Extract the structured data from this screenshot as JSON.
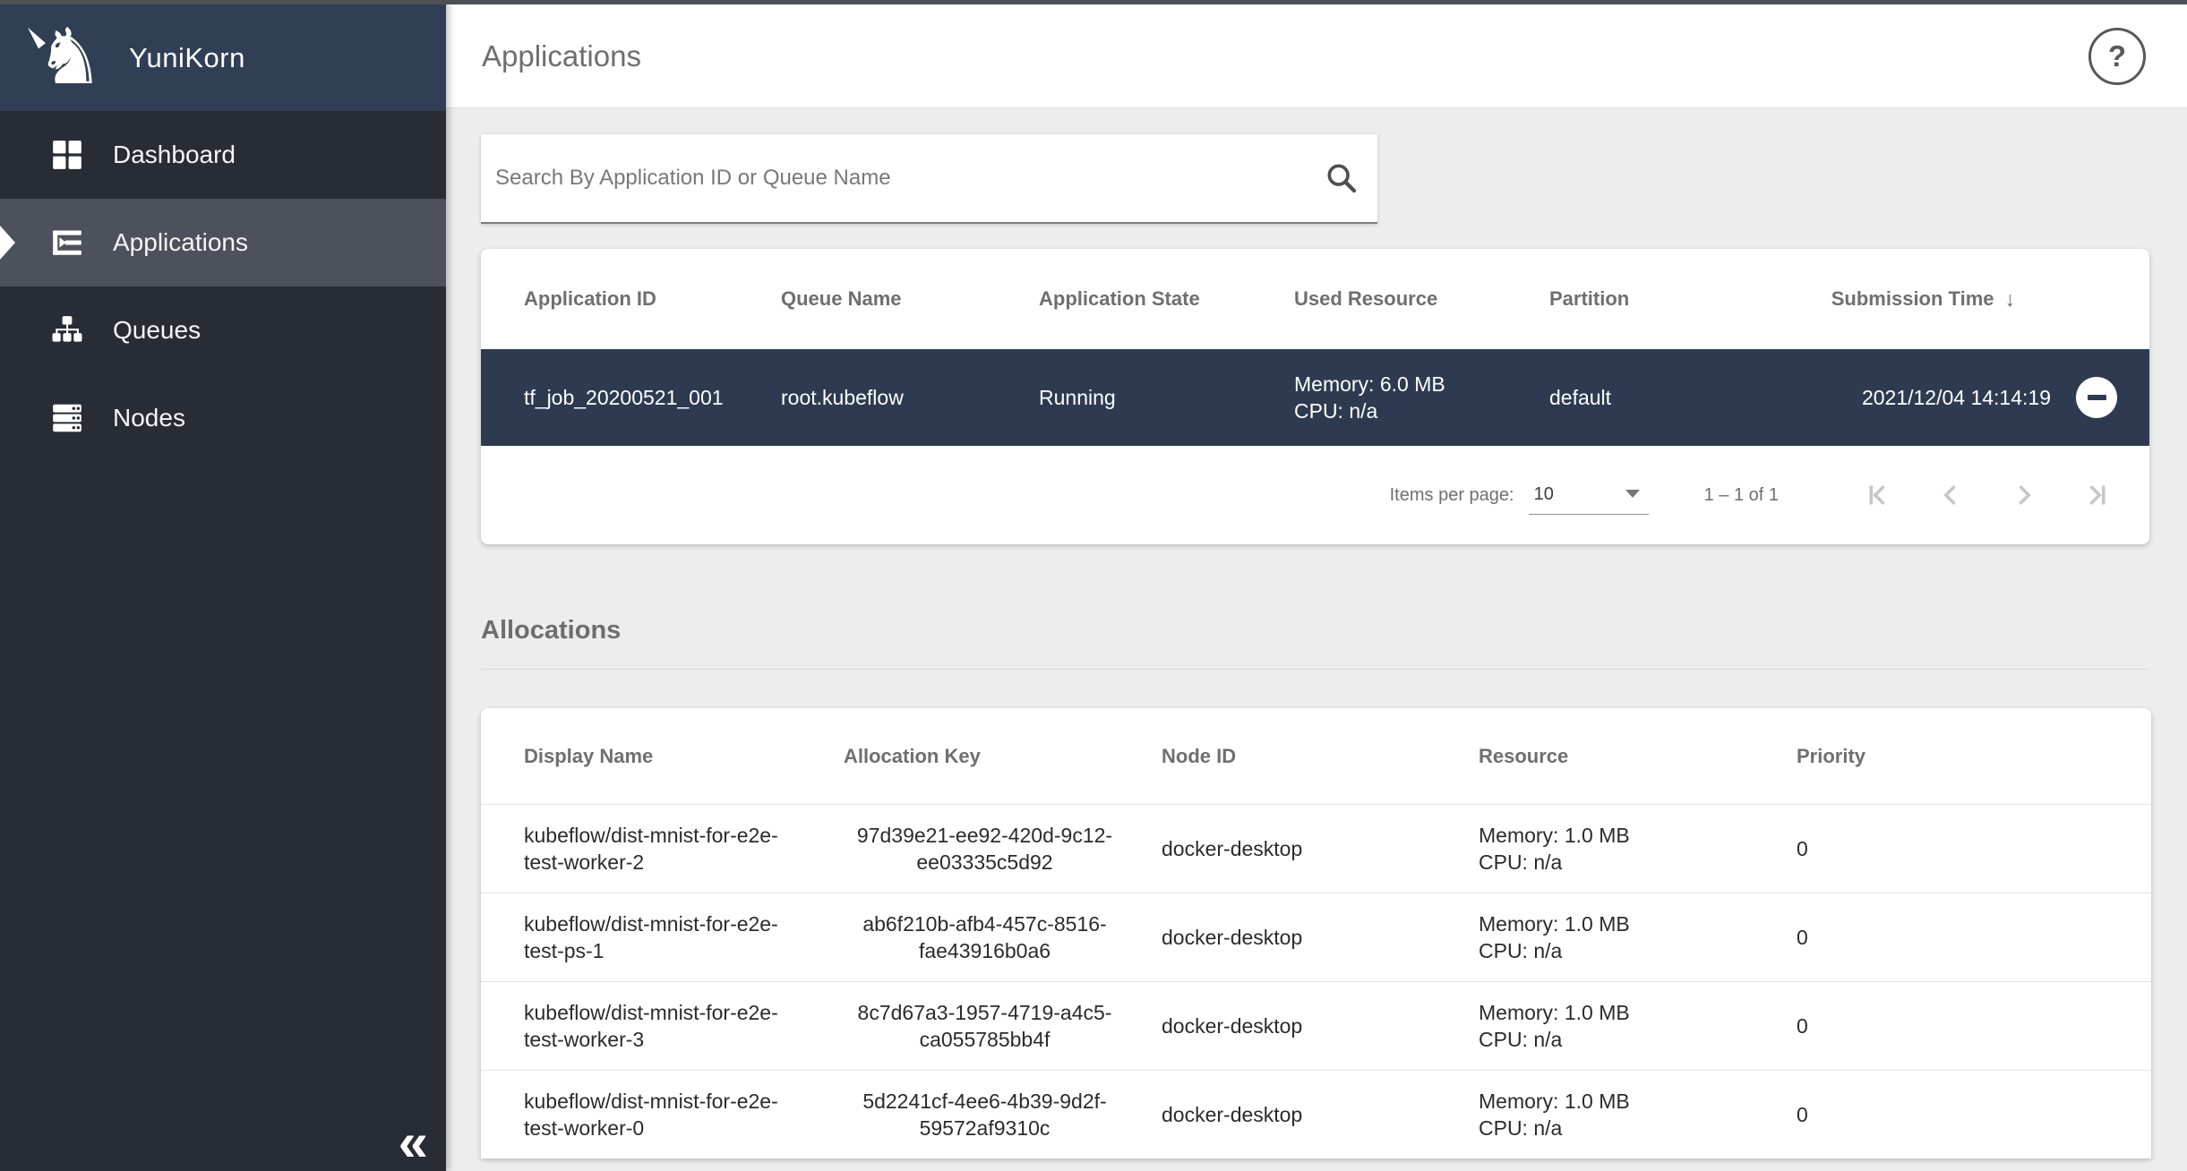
{
  "sidebar": {
    "brand": {
      "title": "YuniKorn"
    },
    "items": [
      {
        "label": "Dashboard"
      },
      {
        "label": "Applications"
      },
      {
        "label": "Queues"
      },
      {
        "label": "Nodes"
      }
    ],
    "collapse_glyph": "«"
  },
  "header": {
    "title": "Applications",
    "help_glyph": "?"
  },
  "search": {
    "placeholder": "Search By Application ID or Queue Name"
  },
  "applications_table": {
    "columns": [
      "Application ID",
      "Queue Name",
      "Application State",
      "Used Resource",
      "Partition",
      "Submission Time"
    ],
    "sort": {
      "column": "Submission Time",
      "direction": "desc",
      "arrow": "↓"
    },
    "rows": [
      {
        "application_id": "tf_job_20200521_001",
        "queue_name": "root.kubeflow",
        "application_state": "Running",
        "used_resource_line1": "Memory: 6.0 MB",
        "used_resource_line2": "CPU: n/a",
        "partition": "default",
        "submission_time": "2021/12/04 14:14:19",
        "selected": true
      }
    ],
    "paginator": {
      "items_per_page_label": "Items per page:",
      "items_per_page_value": "10",
      "range_label": "1 – 1 of 1"
    }
  },
  "allocations": {
    "section_title": "Allocations",
    "columns": [
      "Display Name",
      "Allocation Key",
      "Node ID",
      "Resource",
      "Priority"
    ],
    "rows": [
      {
        "display_name_line1": "kubeflow/dist-mnist-for-e2e-",
        "display_name_line2": "test-worker-2",
        "allocation_key_line1": "97d39e21-ee92-420d-9c12-",
        "allocation_key_line2": "ee03335c5d92",
        "node_id": "docker-desktop",
        "resource_line1": "Memory: 1.0 MB",
        "resource_line2": "CPU: n/a",
        "priority": "0"
      },
      {
        "display_name_line1": "kubeflow/dist-mnist-for-e2e-",
        "display_name_line2": "test-ps-1",
        "allocation_key_line1": "ab6f210b-afb4-457c-8516-",
        "allocation_key_line2": "fae43916b0a6",
        "node_id": "docker-desktop",
        "resource_line1": "Memory: 1.0 MB",
        "resource_line2": "CPU: n/a",
        "priority": "0"
      },
      {
        "display_name_line1": "kubeflow/dist-mnist-for-e2e-",
        "display_name_line2": "test-worker-3",
        "allocation_key_line1": "8c7d67a3-1957-4719-a4c5-",
        "allocation_key_line2": "ca055785bb4f",
        "node_id": "docker-desktop",
        "resource_line1": "Memory: 1.0 MB",
        "resource_line2": "CPU: n/a",
        "priority": "0"
      },
      {
        "display_name_line1": "kubeflow/dist-mnist-for-e2e-",
        "display_name_line2": "test-worker-0",
        "allocation_key_line1": "5d2241cf-4ee6-4b39-9d2f-",
        "allocation_key_line2": "59572af9310c",
        "node_id": "docker-desktop",
        "resource_line1": "Memory: 1.0 MB",
        "resource_line2": "CPU: n/a",
        "priority": "0"
      }
    ]
  },
  "colors": {
    "sidebar_header_bg": "#313f56",
    "sidebar_bg": "#282c34",
    "sidebar_selected_bg": "#4c515b",
    "selected_row_bg": "#2e3a50",
    "content_bg": "#ededed",
    "header_text": "#6f6f6f",
    "disabled_pager": "#c7c7c7"
  }
}
